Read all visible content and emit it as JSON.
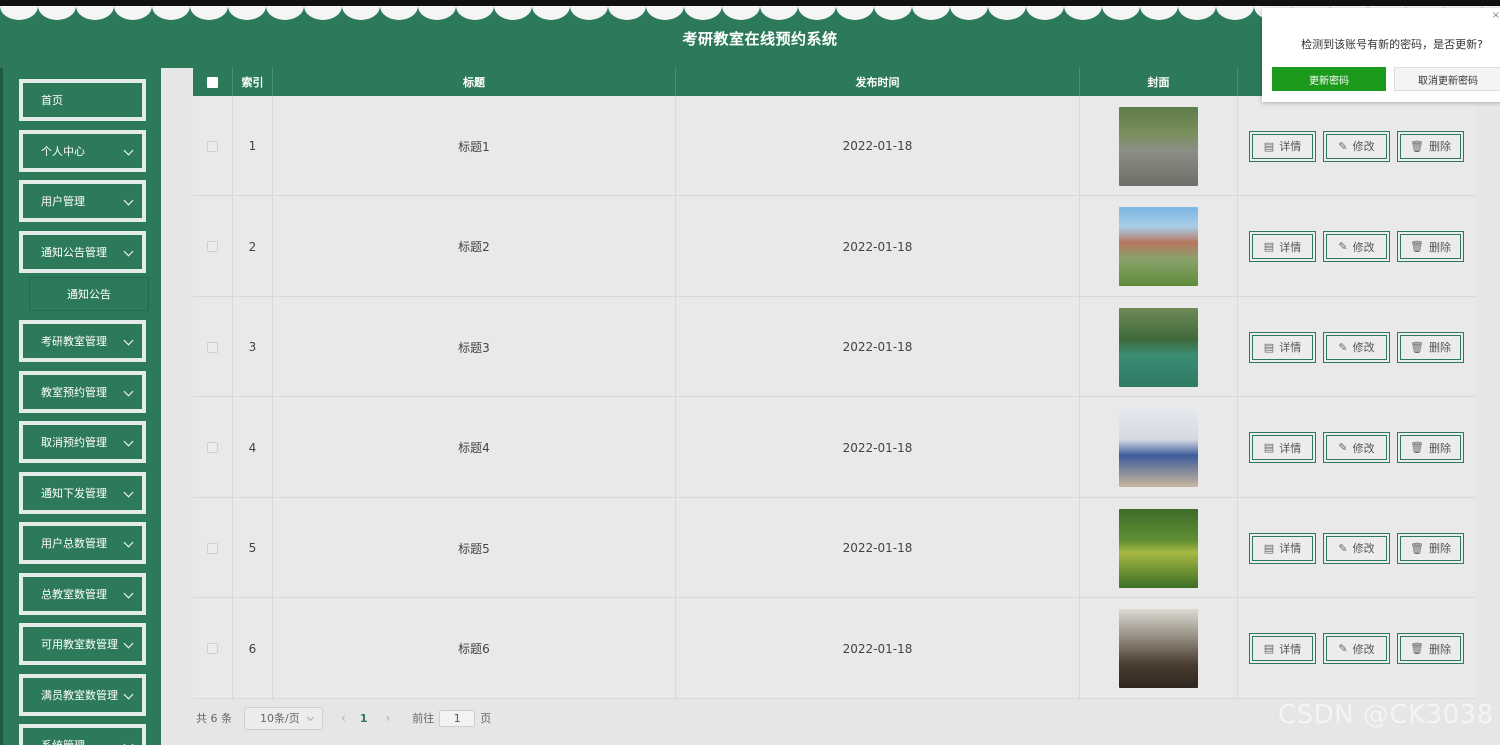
{
  "app": {
    "title": "考研教室在线预约系统"
  },
  "sidebar": {
    "items": [
      {
        "label": "首页",
        "has_arrow": false
      },
      {
        "label": "个人中心",
        "has_arrow": true
      },
      {
        "label": "用户管理",
        "has_arrow": true
      },
      {
        "label": "通知公告管理",
        "has_arrow": true
      },
      {
        "label": "考研教室管理",
        "has_arrow": true
      },
      {
        "label": "教室预约管理",
        "has_arrow": true
      },
      {
        "label": "取消预约管理",
        "has_arrow": true
      },
      {
        "label": "通知下发管理",
        "has_arrow": true
      },
      {
        "label": "用户总数管理",
        "has_arrow": true
      },
      {
        "label": "总教室数管理",
        "has_arrow": true
      },
      {
        "label": "可用教室数管理",
        "has_arrow": true
      },
      {
        "label": "满员教室数管理",
        "has_arrow": true
      },
      {
        "label": "系统管理",
        "has_arrow": true
      }
    ],
    "submenu": {
      "label": "通知公告"
    }
  },
  "table": {
    "headers": {
      "index": "索引",
      "title": "标题",
      "time": "发布时间",
      "cover": "封面"
    },
    "rows": [
      {
        "index": "1",
        "title": "标题1",
        "time": "2022-01-18",
        "cover": "campus-path-photo"
      },
      {
        "index": "2",
        "title": "标题2",
        "time": "2022-01-18",
        "cover": "building-lawn-photo"
      },
      {
        "index": "3",
        "title": "标题3",
        "time": "2022-01-18",
        "cover": "basketball-court-photo"
      },
      {
        "index": "4",
        "title": "标题4",
        "time": "2022-01-18",
        "cover": "dorm-room-photo"
      },
      {
        "index": "5",
        "title": "标题5",
        "time": "2022-01-18",
        "cover": "tree-avenue-photo"
      },
      {
        "index": "6",
        "title": "标题6",
        "time": "2022-01-18",
        "cover": "meeting-room-photo"
      }
    ],
    "actions": {
      "detail": "详情",
      "edit": "修改",
      "delete": "删除"
    }
  },
  "pagination": {
    "total": "共 6 条",
    "page_size": "10条/页",
    "prev": "‹",
    "current_page": "1",
    "next": "›",
    "goto_prefix": "前往",
    "goto_value": "1",
    "goto_suffix": "页"
  },
  "popup": {
    "message": "检测到该账号有新的密码，是否更新?",
    "update_label": "更新密码",
    "cancel_label": "取消更新密码",
    "close": "×"
  },
  "watermark": "CSDN @CK3038",
  "colors": {
    "primary": "#2d7a5b",
    "popup_button": "#1b9a1b",
    "background": "#e6e6e6"
  }
}
